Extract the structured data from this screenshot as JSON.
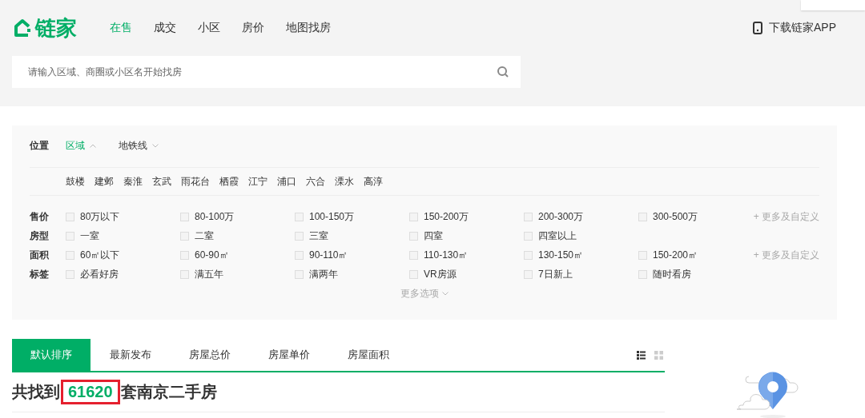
{
  "header": {
    "logo": "链家",
    "nav": [
      {
        "label": "在售",
        "selected": true
      },
      {
        "label": "成交",
        "selected": false
      },
      {
        "label": "小区",
        "selected": false
      },
      {
        "label": "房价",
        "selected": false
      },
      {
        "label": "地图找房",
        "selected": false
      }
    ],
    "download": "下载链家APP",
    "search": {
      "placeholder": "请输入区域、商圈或小区名开始找房"
    }
  },
  "filters": {
    "position": {
      "label": "位置",
      "modes": [
        {
          "label": "区域",
          "selected": true
        },
        {
          "label": "地铁线",
          "selected": false
        }
      ]
    },
    "districts": [
      "鼓楼",
      "建邺",
      "秦淮",
      "玄武",
      "雨花台",
      "栖霞",
      "江宁",
      "浦口",
      "六合",
      "溧水",
      "高淳"
    ],
    "rows": [
      {
        "label": "售价",
        "options": [
          {
            "label": "80万以下",
            "checked": false
          },
          {
            "label": "80-100万",
            "checked": false
          },
          {
            "label": "100-150万",
            "checked": false
          },
          {
            "label": "150-200万",
            "checked": false
          },
          {
            "label": "200-300万",
            "checked": false
          },
          {
            "label": "300-500万",
            "checked": false
          }
        ],
        "more": "+ 更多及自定义"
      },
      {
        "label": "房型",
        "options": [
          {
            "label": "一室",
            "checked": false
          },
          {
            "label": "二室",
            "checked": false
          },
          {
            "label": "三室",
            "checked": false
          },
          {
            "label": "四室",
            "checked": false
          },
          {
            "label": "四室以上",
            "checked": false
          }
        ]
      },
      {
        "label": "面积",
        "options": [
          {
            "label": "60㎡以下",
            "checked": false
          },
          {
            "label": "60-90㎡",
            "checked": false
          },
          {
            "label": "90-110㎡",
            "checked": false
          },
          {
            "label": "110-130㎡",
            "checked": false
          },
          {
            "label": "130-150㎡",
            "checked": false
          },
          {
            "label": "150-200㎡",
            "checked": false
          }
        ],
        "more": "+ 更多及自定义"
      },
      {
        "label": "标签",
        "options": [
          {
            "label": "必看好房",
            "checked": false
          },
          {
            "label": "满五年",
            "checked": false
          },
          {
            "label": "满两年",
            "checked": false
          },
          {
            "label": "VR房源",
            "checked": false
          },
          {
            "label": "7日新上",
            "checked": false
          },
          {
            "label": "随时看房",
            "checked": false
          }
        ]
      }
    ],
    "more_options": "更多选项"
  },
  "sort_tabs": [
    {
      "label": "默认排序",
      "selected": true
    },
    {
      "label": "最新发布",
      "selected": false
    },
    {
      "label": "房屋总价",
      "selected": false
    },
    {
      "label": "房屋单价",
      "selected": false
    },
    {
      "label": "房屋面积",
      "selected": false
    }
  ],
  "view_modes": [
    {
      "kind": "list",
      "selected": true
    },
    {
      "kind": "grid",
      "selected": false
    }
  ],
  "result": {
    "prefix": "共找到",
    "count": "61620",
    "suffix": "套南京二手房"
  }
}
